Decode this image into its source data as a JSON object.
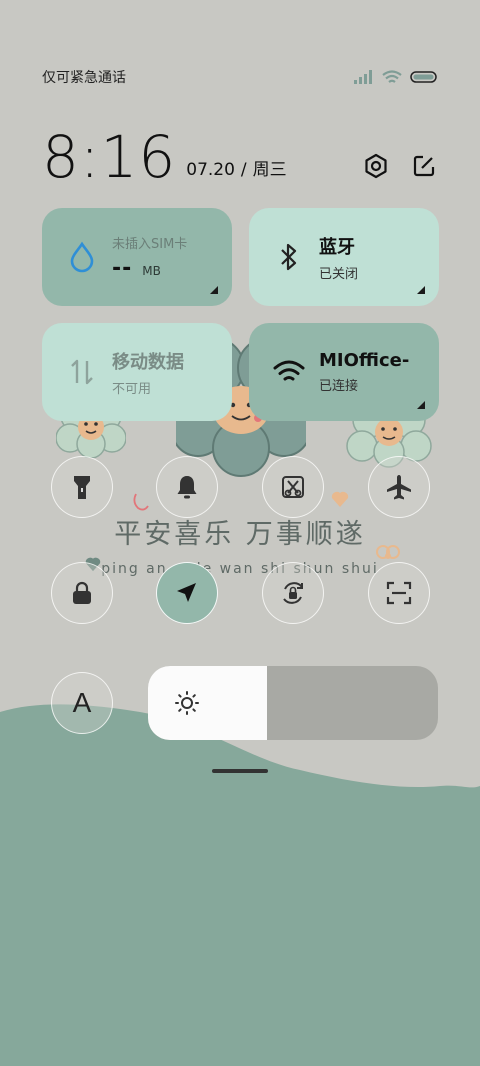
{
  "status_bar": {
    "carrier_text": "仅可紧急通话",
    "icons": [
      "signal-icon",
      "wifi-icon",
      "battery-icon"
    ]
  },
  "clock": {
    "time": "8:16",
    "date": "07.20",
    "separator": "/",
    "weekday": "周三",
    "actions": [
      "settings-icon",
      "edit-icon"
    ]
  },
  "tiles": {
    "data_usage": {
      "title": "未插入SIM卡",
      "value": "--",
      "unit": "MB",
      "icon": "water-drop-icon"
    },
    "bluetooth": {
      "title": "蓝牙",
      "status": "已关闭",
      "icon": "bluetooth-icon"
    },
    "mobile_data": {
      "title": "移动数据",
      "status": "不可用",
      "icon": "data-arrows-icon"
    },
    "wifi": {
      "title": "MIOffice-",
      "status": "已连接",
      "icon": "wifi-icon"
    }
  },
  "toggles_row1": [
    "flashlight-icon",
    "bell-icon",
    "screenshot-icon",
    "airplane-icon"
  ],
  "toggles_row2": [
    "lock-icon",
    "location-icon",
    "rotation-lock-icon",
    "scan-icon"
  ],
  "toggles_active": [
    "location-icon"
  ],
  "auto_brightness_label": "A",
  "brightness": {
    "level": 0.41
  },
  "wallpaper": {
    "slogan_cn": "平安喜乐 万事顺遂",
    "slogan_pinyin": "ping an xi le wan shi shun shui"
  },
  "colors": {
    "background": "#c8c8c3",
    "tile_dark": "#93b7aa",
    "tile_light": "#bfe0d5",
    "wave": "#86a89b",
    "accent_blue": "#2f8fd6"
  }
}
